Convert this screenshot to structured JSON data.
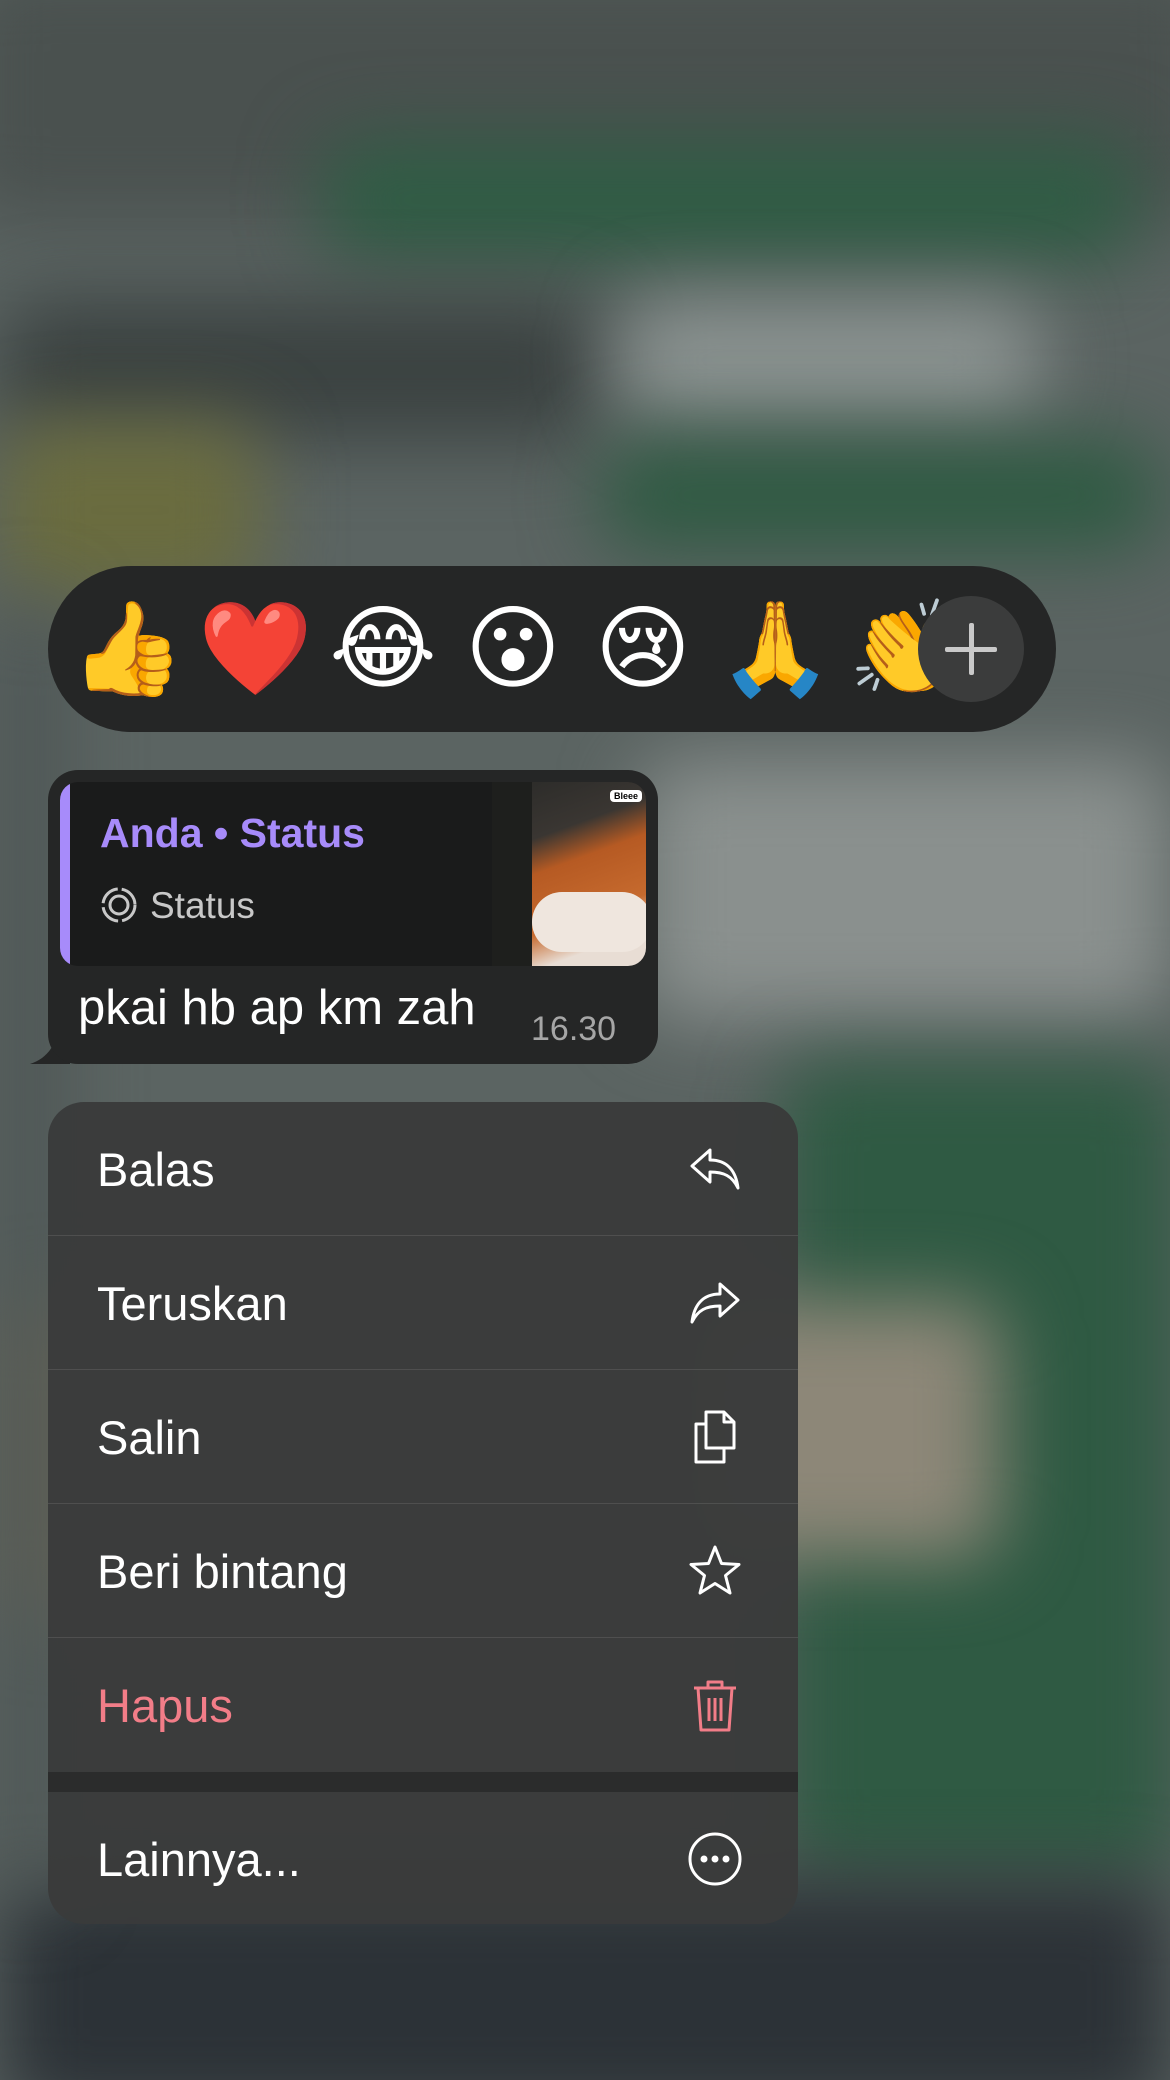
{
  "reactions": {
    "emojis": [
      {
        "name": "thumbs-up",
        "char": "👍"
      },
      {
        "name": "red-heart",
        "char": "❤️"
      },
      {
        "name": "tears-of-joy",
        "char": "😂"
      },
      {
        "name": "surprised",
        "char": "😮"
      },
      {
        "name": "crying",
        "char": "😢"
      },
      {
        "name": "folded-hands",
        "char": "🙏"
      },
      {
        "name": "clapping",
        "char": "👏"
      }
    ],
    "more_icon": "plus-icon"
  },
  "message": {
    "quote": {
      "title": "Anda • Status",
      "subtitle": "Status",
      "accent_color": "#a78bfa",
      "thumbnail_sticker": "Bleee"
    },
    "text": "pkai hb ap km zah",
    "time": "16.30"
  },
  "menu": {
    "items": [
      {
        "label": "Balas",
        "icon": "reply-icon"
      },
      {
        "label": "Teruskan",
        "icon": "forward-icon"
      },
      {
        "label": "Salin",
        "icon": "copy-icon"
      },
      {
        "label": "Beri bintang",
        "icon": "star-icon"
      },
      {
        "label": "Hapus",
        "icon": "trash-icon",
        "color": "#f27d88"
      },
      {
        "label": "Lainnya...",
        "icon": "more-icon"
      }
    ]
  }
}
